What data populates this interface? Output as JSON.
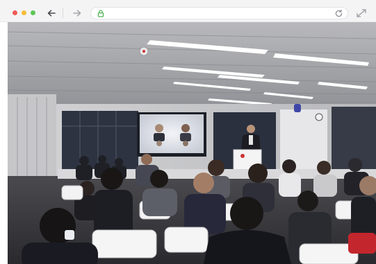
{
  "browser": {
    "window_controls": [
      "close",
      "minimize",
      "maximize"
    ],
    "icons": {
      "back": "arrow-left-icon",
      "forward": "arrow-right-icon",
      "lock": "lock-icon",
      "reload": "reload-icon",
      "expand": "expand-icon"
    },
    "colors": {
      "close": "#ef5b57",
      "minimize": "#f6bd3b",
      "maximize": "#5ec656",
      "lock": "#47b04b"
    }
  },
  "content": {
    "image_subject": "event-photo"
  }
}
